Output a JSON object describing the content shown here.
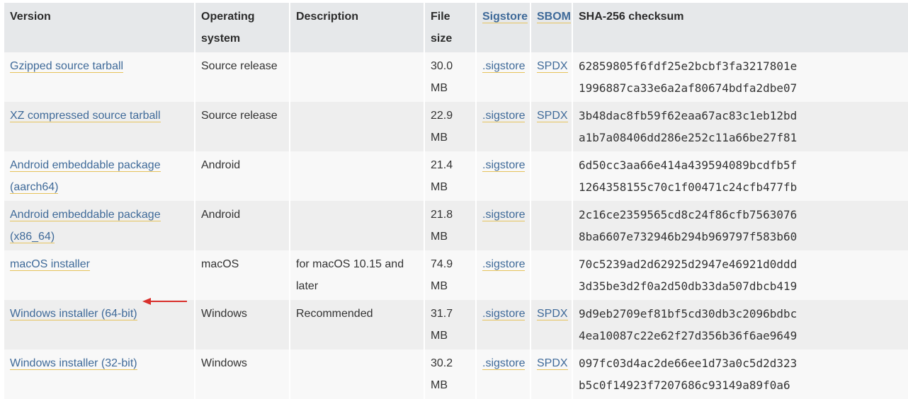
{
  "headers": {
    "version": "Version",
    "os_line1": "Operating",
    "os_line2": "system",
    "description": "Description",
    "size_line1": "File",
    "size_line2": "size",
    "sigstore": "Sigstore",
    "sbom": "SBOM",
    "checksum": "SHA-256 checksum"
  },
  "rows": [
    {
      "version": "Gzipped source tarball",
      "os": "Source release",
      "description": "",
      "size": "30.0 MB",
      "sigstore": ".sigstore",
      "sbom": "SPDX",
      "sha1": "62859805f6fdf25e2bcbf3fa3217801e",
      "sha2": "1996887ca33e6a2af80674bdfa2dbe07"
    },
    {
      "version": "XZ compressed source tarball",
      "os": "Source release",
      "description": "",
      "size": "22.9 MB",
      "sigstore": ".sigstore",
      "sbom": "SPDX",
      "sha1": "3b48dac8fb59f62eaa67ac83c1eb12bd",
      "sha2": "a1b7a08406dd286e252c11a66be27f81"
    },
    {
      "version1": "Android embeddable package",
      "version2": "(aarch64)",
      "os": "Android",
      "description": "",
      "size": "21.4 MB",
      "sigstore": ".sigstore",
      "sbom": "",
      "sha1": "6d50cc3aa66e414a439594089bcdfb5f",
      "sha2": "1264358155c70c1f00471c24cfb477fb"
    },
    {
      "version1": "Android embeddable package",
      "version2": "(x86_64)",
      "os": "Android",
      "description": "",
      "size": "21.8 MB",
      "sigstore": ".sigstore",
      "sbom": "",
      "sha1": "2c16ce2359565cd8c24f86cfb7563076",
      "sha2": "8ba6607e732946b294b969797f583b60"
    },
    {
      "version": "macOS installer",
      "os": "macOS",
      "description1": "for macOS 10.15 and",
      "description2": "later",
      "size": "74.9 MB",
      "sigstore": ".sigstore",
      "sbom": "",
      "sha1": "70c5239ad2d62925d2947e46921d0ddd",
      "sha2": "3d35be3d2f0a2d50db33da507dbcb419"
    },
    {
      "version": "Windows installer (64-bit)",
      "os": "Windows",
      "description": "Recommended",
      "size": "31.7 MB",
      "sigstore": ".sigstore",
      "sbom": "SPDX",
      "sha1": "9d9eb2709ef81bf5cd30db3c2096bdbc",
      "sha2": "4ea10087c22e62f27d356b36f6ae9649"
    },
    {
      "version": "Windows installer (32-bit)",
      "os": "Windows",
      "description": "",
      "size": "30.2 MB",
      "sigstore": ".sigstore",
      "sbom": "SPDX",
      "sha1": "097fc03d4ac2de66ee1d73a0c5d2d323",
      "sha2": "b5c0f14923f7207686c93149a89f0a6"
    }
  ],
  "colors": {
    "link": "#3f6a99",
    "link_underline": "#e6c35c",
    "checksum_text": "#2e8b2e",
    "header_bg": "#e6e8ea",
    "arrow": "#d9302c"
  }
}
